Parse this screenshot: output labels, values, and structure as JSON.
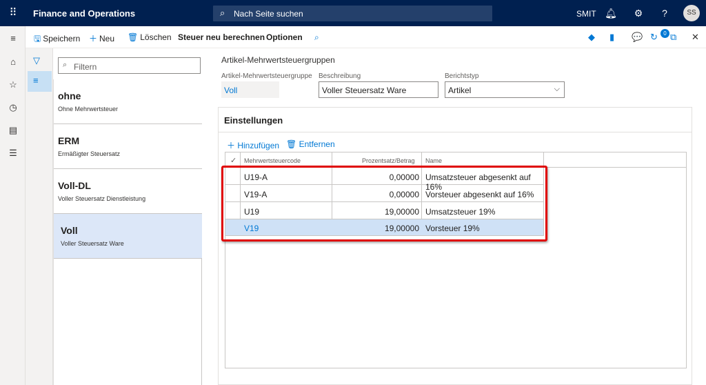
{
  "app": {
    "title": "Finance and Operations",
    "search_placeholder": "Nach Seite suchen",
    "company": "SMIT",
    "user_initials": "SS",
    "notification_count": "0"
  },
  "toolbar": {
    "save": "Speichern",
    "new": "Neu",
    "delete": "Löschen",
    "recalc": "Steuer neu berechnen",
    "options": "Optionen"
  },
  "list": {
    "filter_placeholder": "Filtern",
    "items": [
      {
        "title": "ohne",
        "subtitle": "Ohne Mehrwertsteuer"
      },
      {
        "title": "ERM",
        "subtitle": "Ermäßigter Steuersatz"
      },
      {
        "title": "Voll-DL",
        "subtitle": "Voller Steuersatz Dienstleistung"
      },
      {
        "title": "Voll",
        "subtitle": "Voller Steuersatz Ware"
      }
    ]
  },
  "detail": {
    "title": "Artikel-Mehrwertsteuergruppen",
    "group_label": "Artikel-Mehrwertsteuergruppe",
    "group_value": "Voll",
    "desc_label": "Beschreibung",
    "desc_value": "Voller Steuersatz Ware",
    "type_label": "Berichtstyp",
    "type_value": "Artikel"
  },
  "settings": {
    "title": "Einstellungen",
    "add": "Hinzufügen",
    "remove": "Entfernen",
    "columns": [
      "Mehrwertsteuercode",
      "Prozentsatz/Betrag",
      "Name"
    ],
    "rows": [
      {
        "code": "U19-A",
        "rate": "0,00000",
        "name": "Umsatzsteuer abgesenkt auf 16%"
      },
      {
        "code": "V19-A",
        "rate": "0,00000",
        "name": "Vorsteuer abgesenkt auf 16%"
      },
      {
        "code": "U19",
        "rate": "19,00000",
        "name": "Umsatzsteuer 19%"
      },
      {
        "code": "V19",
        "rate": "19,00000",
        "name": "Vorsteuer 19%"
      }
    ]
  },
  "colors": {
    "topbar": "#002050",
    "accent": "#0078d4",
    "highlight": "#e00000",
    "selected_row": "#cfe1f6"
  }
}
